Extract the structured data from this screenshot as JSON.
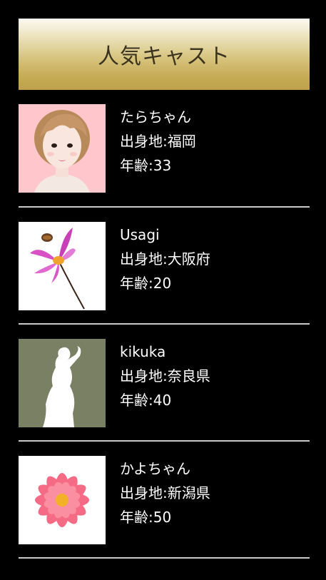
{
  "header": {
    "title": "人気キャスト"
  },
  "cast": [
    {
      "name": "たらちゃん",
      "hometown": "出身地:福岡",
      "age": "年齢:33",
      "image_icon": "woman-portrait-icon",
      "bg": "#ffc6cc"
    },
    {
      "name": "Usagi",
      "hometown": "出身地:大阪府",
      "age": "年齢:20",
      "image_icon": "pink-flower-with-bee-icon",
      "bg": "#ffffff"
    },
    {
      "name": "kikuka",
      "hometown": "出身地:奈良県",
      "age": "年齢:40",
      "image_icon": "woman-silhouette-icon",
      "bg": "#7a8064"
    },
    {
      "name": "かよちゃん",
      "hometown": "出身地:新潟県",
      "age": "年齢:50",
      "image_icon": "pink-dahlia-icon",
      "bg": "#ffffff"
    }
  ],
  "colors": {
    "background": "#000000",
    "header_gold": "#c6ab55",
    "divider": "#c9c9c9",
    "text": "#ffffff"
  }
}
